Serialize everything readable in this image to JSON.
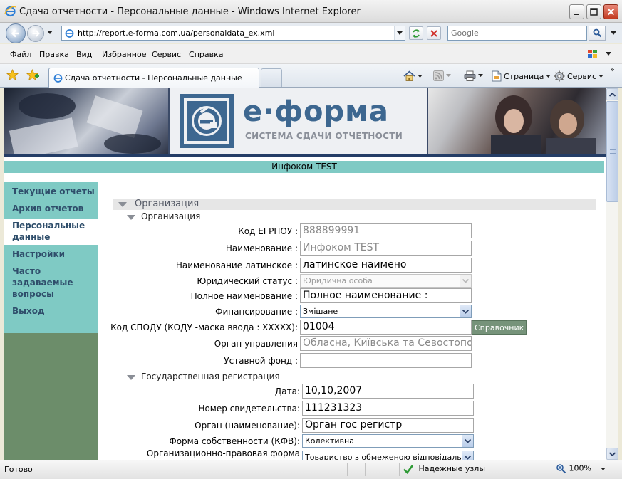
{
  "window": {
    "title": "Сдача отчетности - Персональные данные - Windows Internet Explorer"
  },
  "address_bar": {
    "url": "http://report.e-forma.com.ua/personaldata_ex.xml",
    "search_placeholder": "Google"
  },
  "menu": {
    "items": [
      {
        "u": "Ф",
        "rest": "айл"
      },
      {
        "u": "П",
        "rest": "равка"
      },
      {
        "u": "В",
        "rest": "ид"
      },
      {
        "u": "И",
        "rest": "збранное"
      },
      {
        "u": "С",
        "rest": "ервис"
      },
      {
        "u": "С",
        "rest": "правка"
      }
    ]
  },
  "tabs": {
    "active_label": "Сдача отчетности - Персональные данные"
  },
  "command_bar": {
    "page_label": "Страница",
    "tools_label": "Сервис",
    "chevrons": "»"
  },
  "banner": {
    "logo_name": "е·форма",
    "logo_subtitle": "СИСТЕМА СДАЧИ ОТЧЕТНОСТИ"
  },
  "company_name": "Инфоком TEST",
  "sidebar": {
    "items": [
      {
        "label": "Текущие отчеты"
      },
      {
        "label": "Архив отчетов"
      },
      {
        "label_line1": "Персональные",
        "label_line2": "данные"
      },
      {
        "label": "Настройки"
      },
      {
        "label_line1": "Часто",
        "label_line2": "задаваемые",
        "label_line3": "вопросы"
      },
      {
        "label": "Выход"
      }
    ]
  },
  "form": {
    "section_title": "Организация",
    "org_subsection": "Организация",
    "fields": {
      "edrpou_label": "Код ЕГРПОУ :",
      "edrpou_value": "888899991",
      "name_label": "Наименование :",
      "name_value": "Инфоком TEST",
      "name_latin_label": "Наименование латинское :",
      "name_latin_value": "латинское наимено",
      "legal_status_label": "Юридический статус :",
      "legal_status_value": "Юридична особа",
      "full_name_label": "Полное наименование :",
      "full_name_value": "Полное наименование :",
      "financing_label": "Финансирование :",
      "financing_value": "Змішане",
      "spodu_label": "Код СПОДУ (КОДУ -маска ввода : XXXXX):",
      "spodu_value": "01004",
      "spodu_button": "Справочник",
      "authority_label": "Орган управления",
      "authority_value": "Обласна, Київська та Севостопольс",
      "capital_label": "Уставной фонд :",
      "capital_value": ""
    },
    "registration_subsection": "Государственная регистрация",
    "registration": {
      "date_label": "Дата:",
      "date_value": "10,10,2007",
      "cert_label": "Номер свидетельства:",
      "cert_value": "111231323",
      "organ_label": "Орган (наименование):",
      "organ_value": "Орган гос регистр",
      "ownership_label": "Форма собственности (КФВ):",
      "ownership_value": "Колективна",
      "org_legal_label": "Организационно-правовая форма",
      "org_legal_value": "Товариство з обмеженою відповідальністю"
    }
  },
  "status_bar": {
    "status": "Готово",
    "zone": "Надежные узлы",
    "zoom": "100%"
  }
}
